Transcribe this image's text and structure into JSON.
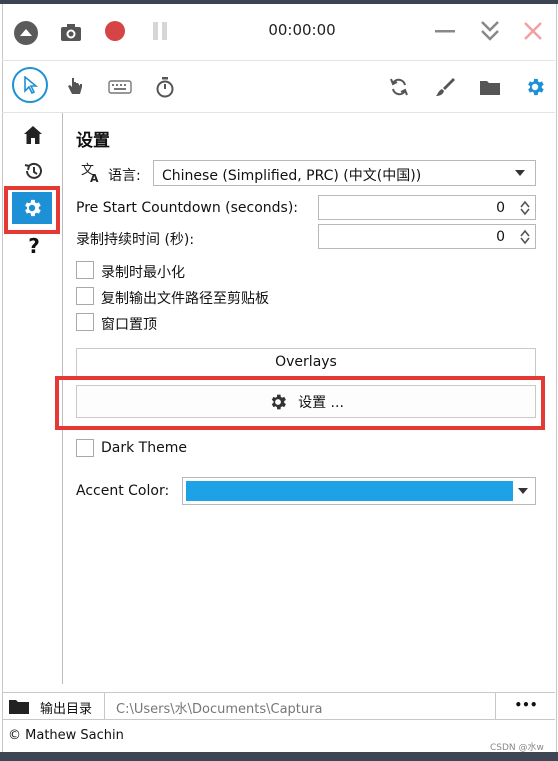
{
  "titlebar": {
    "timer": "00:00:00"
  },
  "toolbar": {
    "tools": [
      "pointer-icon",
      "hand-icon",
      "keyboard-icon",
      "stopwatch-icon"
    ],
    "right_tools": [
      "refresh-icon",
      "brush-icon",
      "folder-icon",
      "settings-icon"
    ]
  },
  "sidebar": {
    "items": [
      "home-icon",
      "history-icon",
      "settings-icon",
      "help-icon"
    ],
    "help_label": "?"
  },
  "settings": {
    "title": "设置",
    "language_label": "语言:",
    "language_value": "Chinese (Simplified, PRC) (中文(中国))",
    "countdown_label": "Pre Start Countdown (seconds):",
    "countdown_value": "0",
    "duration_label": "录制持续时间 (秒):",
    "duration_value": "0",
    "checkboxes": [
      "录制时最小化",
      "复制输出文件路径至剪贴板",
      "窗口置顶"
    ],
    "overlays_label": "Overlays",
    "overlay_settings_label": "设置 ...",
    "dark_theme_label": "Dark Theme",
    "accent_label": "Accent Color:",
    "accent_color": "#1ea2e6"
  },
  "footer": {
    "output_label": "输出目录",
    "output_path": "C:\\Users\\水\\Documents\\Captura",
    "more_label": "•••",
    "copyright": "© Mathew Sachin",
    "watermark": "CSDN @水w"
  },
  "colors": {
    "accent": "#1e90d6",
    "record": "#d64545",
    "highlight": "#e53935"
  }
}
